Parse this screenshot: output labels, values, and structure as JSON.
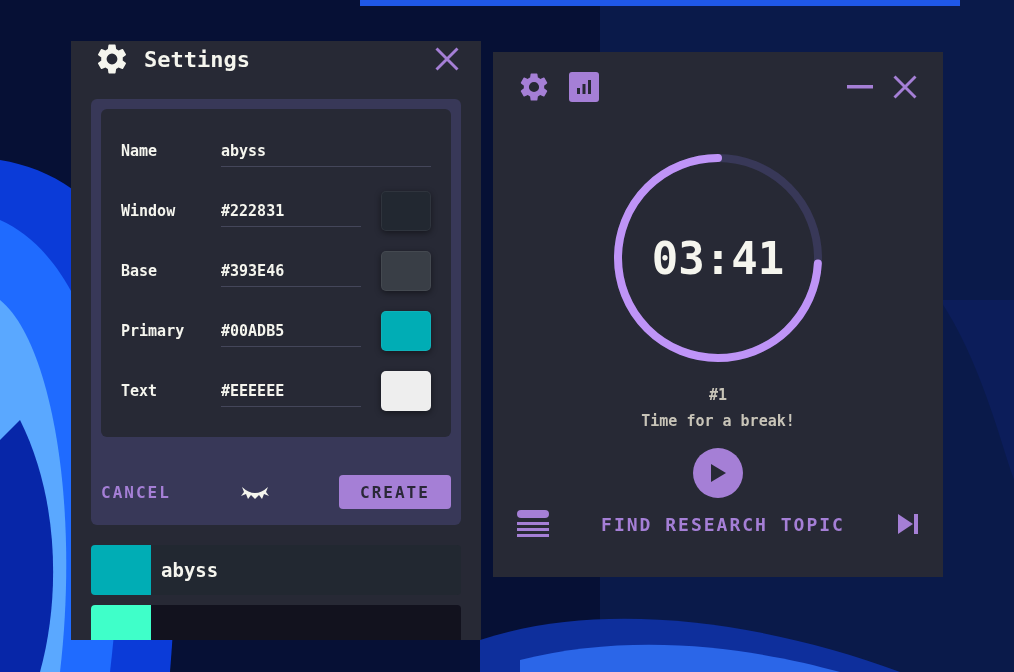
{
  "settings_window": {
    "title": "Settings",
    "fields": [
      {
        "label": "Name",
        "value": "abyss",
        "kind": "text"
      },
      {
        "label": "Window",
        "value": "#222831",
        "kind": "color",
        "color": "#222831"
      },
      {
        "label": "Base",
        "value": "#393E46",
        "kind": "color",
        "color": "#393e46"
      },
      {
        "label": "Primary",
        "value": "#00ADB5",
        "kind": "color",
        "color": "#00adb5"
      },
      {
        "label": "Text",
        "value": "#EEEEEE",
        "kind": "color",
        "color": "#eeeeee"
      }
    ],
    "buttons": [
      {
        "label": "CANCEL",
        "kind": "text"
      },
      {
        "label": "CREATE",
        "kind": "filled"
      }
    ],
    "themes": [
      {
        "name": "abyss",
        "color": "#00adb5"
      },
      {
        "color": "#3fffc9"
      }
    ]
  },
  "timer_window": {
    "time": "03:41",
    "level": 0.74,
    "round": "#1",
    "message": "Time for a break!",
    "task": "FIND RESEARCH TOPIC"
  }
}
